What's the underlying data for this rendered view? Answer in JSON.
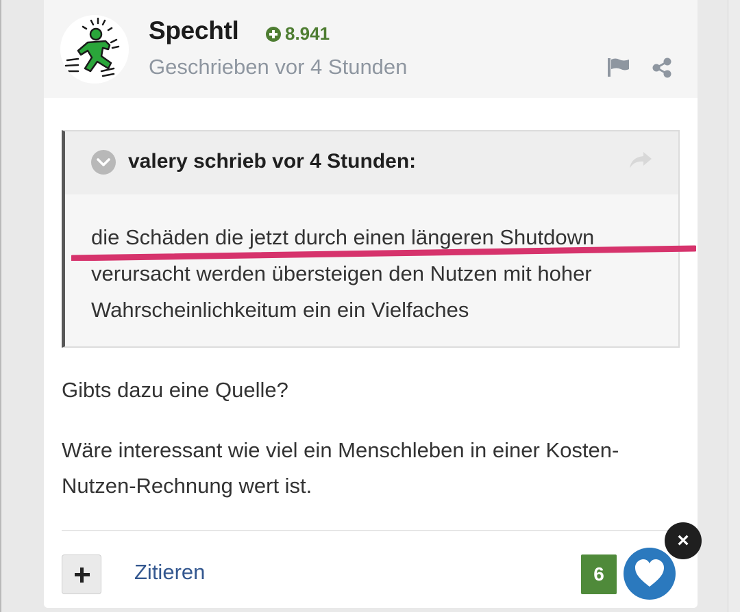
{
  "author": {
    "name": "Spechtl",
    "reputation": "8.941",
    "meta": "Geschrieben vor 4 Stunden",
    "avatar_icon": "running-figure-avatar"
  },
  "header_actions": {
    "report_icon": "flag-icon",
    "share_icon": "share-icon"
  },
  "quote": {
    "citation": "valery schrieb vor 4 Stunden:",
    "lines": [
      "die Schäden die jetzt durch einen längeren Shutdown",
      "verursacht werden übersteigen den Nutzen mit hoher",
      "Wahrscheinlichkeitum ein ein Vielfaches"
    ]
  },
  "body": {
    "p1": "Gibts dazu eine Quelle?",
    "p2_lines": [
      "Wäre interessant wie viel ein Menschleben in einer Kosten-",
      "Nutzen-Rechnung wert ist."
    ]
  },
  "footer": {
    "quote_label": "Zitieren",
    "reaction_count": "6",
    "close_label": "×"
  },
  "colors": {
    "reputation": "#4e7d32",
    "link": "#33578f",
    "reaction_count_bg": "#4f8a3a",
    "reaction_button": "#2b79be",
    "highlight_stroke": "#d6336c"
  }
}
